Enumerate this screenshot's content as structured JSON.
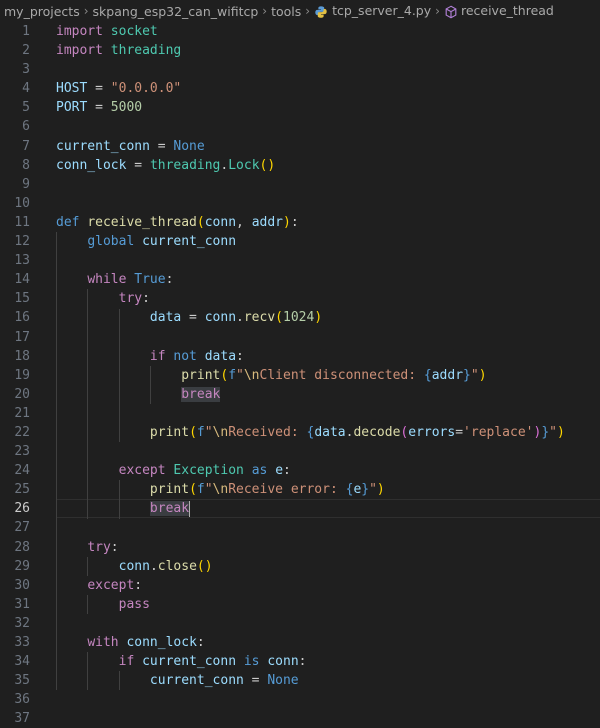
{
  "breadcrumb": {
    "items": [
      "my_projects",
      "skpang_esp32_can_wifitcp",
      "tools",
      "tcp_server_4.py",
      "receive_thread"
    ],
    "separator": ">"
  },
  "icons": {
    "file": "python-file-icon",
    "symbol": "method-symbol-icon"
  },
  "colors": {
    "background": "#1f1f1f",
    "keyword": "#c586c0",
    "declaration": "#569cd6",
    "module": "#4ec9b0",
    "variable": "#9cdcfe",
    "function": "#dcdcaa",
    "string": "#ce9178",
    "number": "#b5cea8"
  },
  "editor": {
    "active_line": 26,
    "lines": [
      {
        "n": "1",
        "tokens": [
          [
            "kw",
            "import"
          ],
          [
            "plain",
            " "
          ],
          [
            "mod",
            "socket"
          ]
        ]
      },
      {
        "n": "2",
        "tokens": [
          [
            "kw",
            "import"
          ],
          [
            "plain",
            " "
          ],
          [
            "mod",
            "threading"
          ]
        ]
      },
      {
        "n": "3",
        "tokens": []
      },
      {
        "n": "4",
        "tokens": [
          [
            "var",
            "HOST"
          ],
          [
            "plain",
            " = "
          ],
          [
            "str",
            "\"0.0.0.0\""
          ]
        ]
      },
      {
        "n": "5",
        "tokens": [
          [
            "var",
            "PORT"
          ],
          [
            "plain",
            " = "
          ],
          [
            "num",
            "5000"
          ]
        ]
      },
      {
        "n": "6",
        "tokens": []
      },
      {
        "n": "7",
        "tokens": [
          [
            "var",
            "current_conn"
          ],
          [
            "plain",
            " = "
          ],
          [
            "decl",
            "None"
          ]
        ]
      },
      {
        "n": "8",
        "tokens": [
          [
            "var",
            "conn_lock"
          ],
          [
            "plain",
            " = "
          ],
          [
            "mod",
            "threading"
          ],
          [
            "plain",
            "."
          ],
          [
            "mod",
            "Lock"
          ],
          [
            "br1",
            "()"
          ]
        ]
      },
      {
        "n": "9",
        "tokens": []
      },
      {
        "n": "10",
        "tokens": []
      },
      {
        "n": "11",
        "tokens": [
          [
            "decl",
            "def"
          ],
          [
            "plain",
            " "
          ],
          [
            "fn",
            "receive_thread"
          ],
          [
            "br1",
            "("
          ],
          [
            "var",
            "conn"
          ],
          [
            "plain",
            ", "
          ],
          [
            "var",
            "addr"
          ],
          [
            "br1",
            ")"
          ],
          [
            "plain",
            ":"
          ]
        ]
      },
      {
        "n": "12",
        "tokens": [
          [
            "plain",
            "    "
          ],
          [
            "decl",
            "global"
          ],
          [
            "plain",
            " "
          ],
          [
            "var",
            "current_conn"
          ]
        ]
      },
      {
        "n": "13",
        "tokens": []
      },
      {
        "n": "14",
        "tokens": [
          [
            "plain",
            "    "
          ],
          [
            "kw",
            "while"
          ],
          [
            "plain",
            " "
          ],
          [
            "decl",
            "True"
          ],
          [
            "plain",
            ":"
          ]
        ]
      },
      {
        "n": "15",
        "tokens": [
          [
            "plain",
            "        "
          ],
          [
            "kw",
            "try"
          ],
          [
            "plain",
            ":"
          ]
        ]
      },
      {
        "n": "16",
        "tokens": [
          [
            "plain",
            "            "
          ],
          [
            "var",
            "data"
          ],
          [
            "plain",
            " = "
          ],
          [
            "var",
            "conn"
          ],
          [
            "plain",
            "."
          ],
          [
            "fn",
            "recv"
          ],
          [
            "br1",
            "("
          ],
          [
            "num",
            "1024"
          ],
          [
            "br1",
            ")"
          ]
        ]
      },
      {
        "n": "17",
        "tokens": []
      },
      {
        "n": "18",
        "tokens": [
          [
            "plain",
            "            "
          ],
          [
            "kw",
            "if"
          ],
          [
            "plain",
            " "
          ],
          [
            "decl",
            "not"
          ],
          [
            "plain",
            " "
          ],
          [
            "var",
            "data"
          ],
          [
            "plain",
            ":"
          ]
        ]
      },
      {
        "n": "19",
        "tokens": [
          [
            "plain",
            "                "
          ],
          [
            "fn",
            "print"
          ],
          [
            "br1",
            "("
          ],
          [
            "fbr",
            "f"
          ],
          [
            "str",
            "\""
          ],
          [
            "esc",
            "\\n"
          ],
          [
            "str",
            "Client disconnected: "
          ],
          [
            "fbr",
            "{"
          ],
          [
            "var",
            "addr"
          ],
          [
            "fbr",
            "}"
          ],
          [
            "str",
            "\""
          ],
          [
            "br1",
            ")"
          ]
        ]
      },
      {
        "n": "20",
        "tokens": [
          [
            "plain",
            "                "
          ],
          [
            "kw",
            "break"
          ]
        ],
        "sel": true
      },
      {
        "n": "21",
        "tokens": []
      },
      {
        "n": "22",
        "tokens": [
          [
            "plain",
            "            "
          ],
          [
            "fn",
            "print"
          ],
          [
            "br1",
            "("
          ],
          [
            "fbr",
            "f"
          ],
          [
            "str",
            "\""
          ],
          [
            "esc",
            "\\n"
          ],
          [
            "str",
            "Received: "
          ],
          [
            "fbr",
            "{"
          ],
          [
            "var",
            "data"
          ],
          [
            "plain",
            "."
          ],
          [
            "fn",
            "decode"
          ],
          [
            "br2",
            "("
          ],
          [
            "var",
            "errors"
          ],
          [
            "plain",
            "="
          ],
          [
            "str",
            "'replace'"
          ],
          [
            "br2",
            ")"
          ],
          [
            "fbr",
            "}"
          ],
          [
            "str",
            "\""
          ],
          [
            "br1",
            ")"
          ]
        ]
      },
      {
        "n": "23",
        "tokens": []
      },
      {
        "n": "24",
        "tokens": [
          [
            "plain",
            "        "
          ],
          [
            "kw",
            "except"
          ],
          [
            "plain",
            " "
          ],
          [
            "mod",
            "Exception"
          ],
          [
            "plain",
            " "
          ],
          [
            "decl",
            "as"
          ],
          [
            "plain",
            " "
          ],
          [
            "var",
            "e"
          ],
          [
            "plain",
            ":"
          ]
        ]
      },
      {
        "n": "25",
        "tokens": [
          [
            "plain",
            "            "
          ],
          [
            "fn",
            "print"
          ],
          [
            "br1",
            "("
          ],
          [
            "fbr",
            "f"
          ],
          [
            "str",
            "\""
          ],
          [
            "esc",
            "\\n"
          ],
          [
            "str",
            "Receive error: "
          ],
          [
            "fbr",
            "{"
          ],
          [
            "var",
            "e"
          ],
          [
            "fbr",
            "}"
          ],
          [
            "str",
            "\""
          ],
          [
            "br1",
            ")"
          ]
        ]
      },
      {
        "n": "26",
        "tokens": [
          [
            "plain",
            "            "
          ],
          [
            "kw",
            "break"
          ]
        ],
        "sel": true,
        "cursor": true
      },
      {
        "n": "27",
        "tokens": []
      },
      {
        "n": "28",
        "tokens": [
          [
            "plain",
            "    "
          ],
          [
            "kw",
            "try"
          ],
          [
            "plain",
            ":"
          ]
        ]
      },
      {
        "n": "29",
        "tokens": [
          [
            "plain",
            "        "
          ],
          [
            "var",
            "conn"
          ],
          [
            "plain",
            "."
          ],
          [
            "fn",
            "close"
          ],
          [
            "br1",
            "()"
          ]
        ]
      },
      {
        "n": "30",
        "tokens": [
          [
            "plain",
            "    "
          ],
          [
            "kw",
            "except"
          ],
          [
            "plain",
            ":"
          ]
        ]
      },
      {
        "n": "31",
        "tokens": [
          [
            "plain",
            "        "
          ],
          [
            "kw",
            "pass"
          ]
        ]
      },
      {
        "n": "32",
        "tokens": []
      },
      {
        "n": "33",
        "tokens": [
          [
            "plain",
            "    "
          ],
          [
            "kw",
            "with"
          ],
          [
            "plain",
            " "
          ],
          [
            "var",
            "conn_lock"
          ],
          [
            "plain",
            ":"
          ]
        ]
      },
      {
        "n": "34",
        "tokens": [
          [
            "plain",
            "        "
          ],
          [
            "kw",
            "if"
          ],
          [
            "plain",
            " "
          ],
          [
            "var",
            "current_conn"
          ],
          [
            "plain",
            " "
          ],
          [
            "decl",
            "is"
          ],
          [
            "plain",
            " "
          ],
          [
            "var",
            "conn"
          ],
          [
            "plain",
            ":"
          ]
        ]
      },
      {
        "n": "35",
        "tokens": [
          [
            "plain",
            "            "
          ],
          [
            "var",
            "current_conn"
          ],
          [
            "plain",
            " = "
          ],
          [
            "decl",
            "None"
          ]
        ]
      },
      {
        "n": "36",
        "tokens": []
      },
      {
        "n": "37",
        "tokens": []
      }
    ]
  }
}
